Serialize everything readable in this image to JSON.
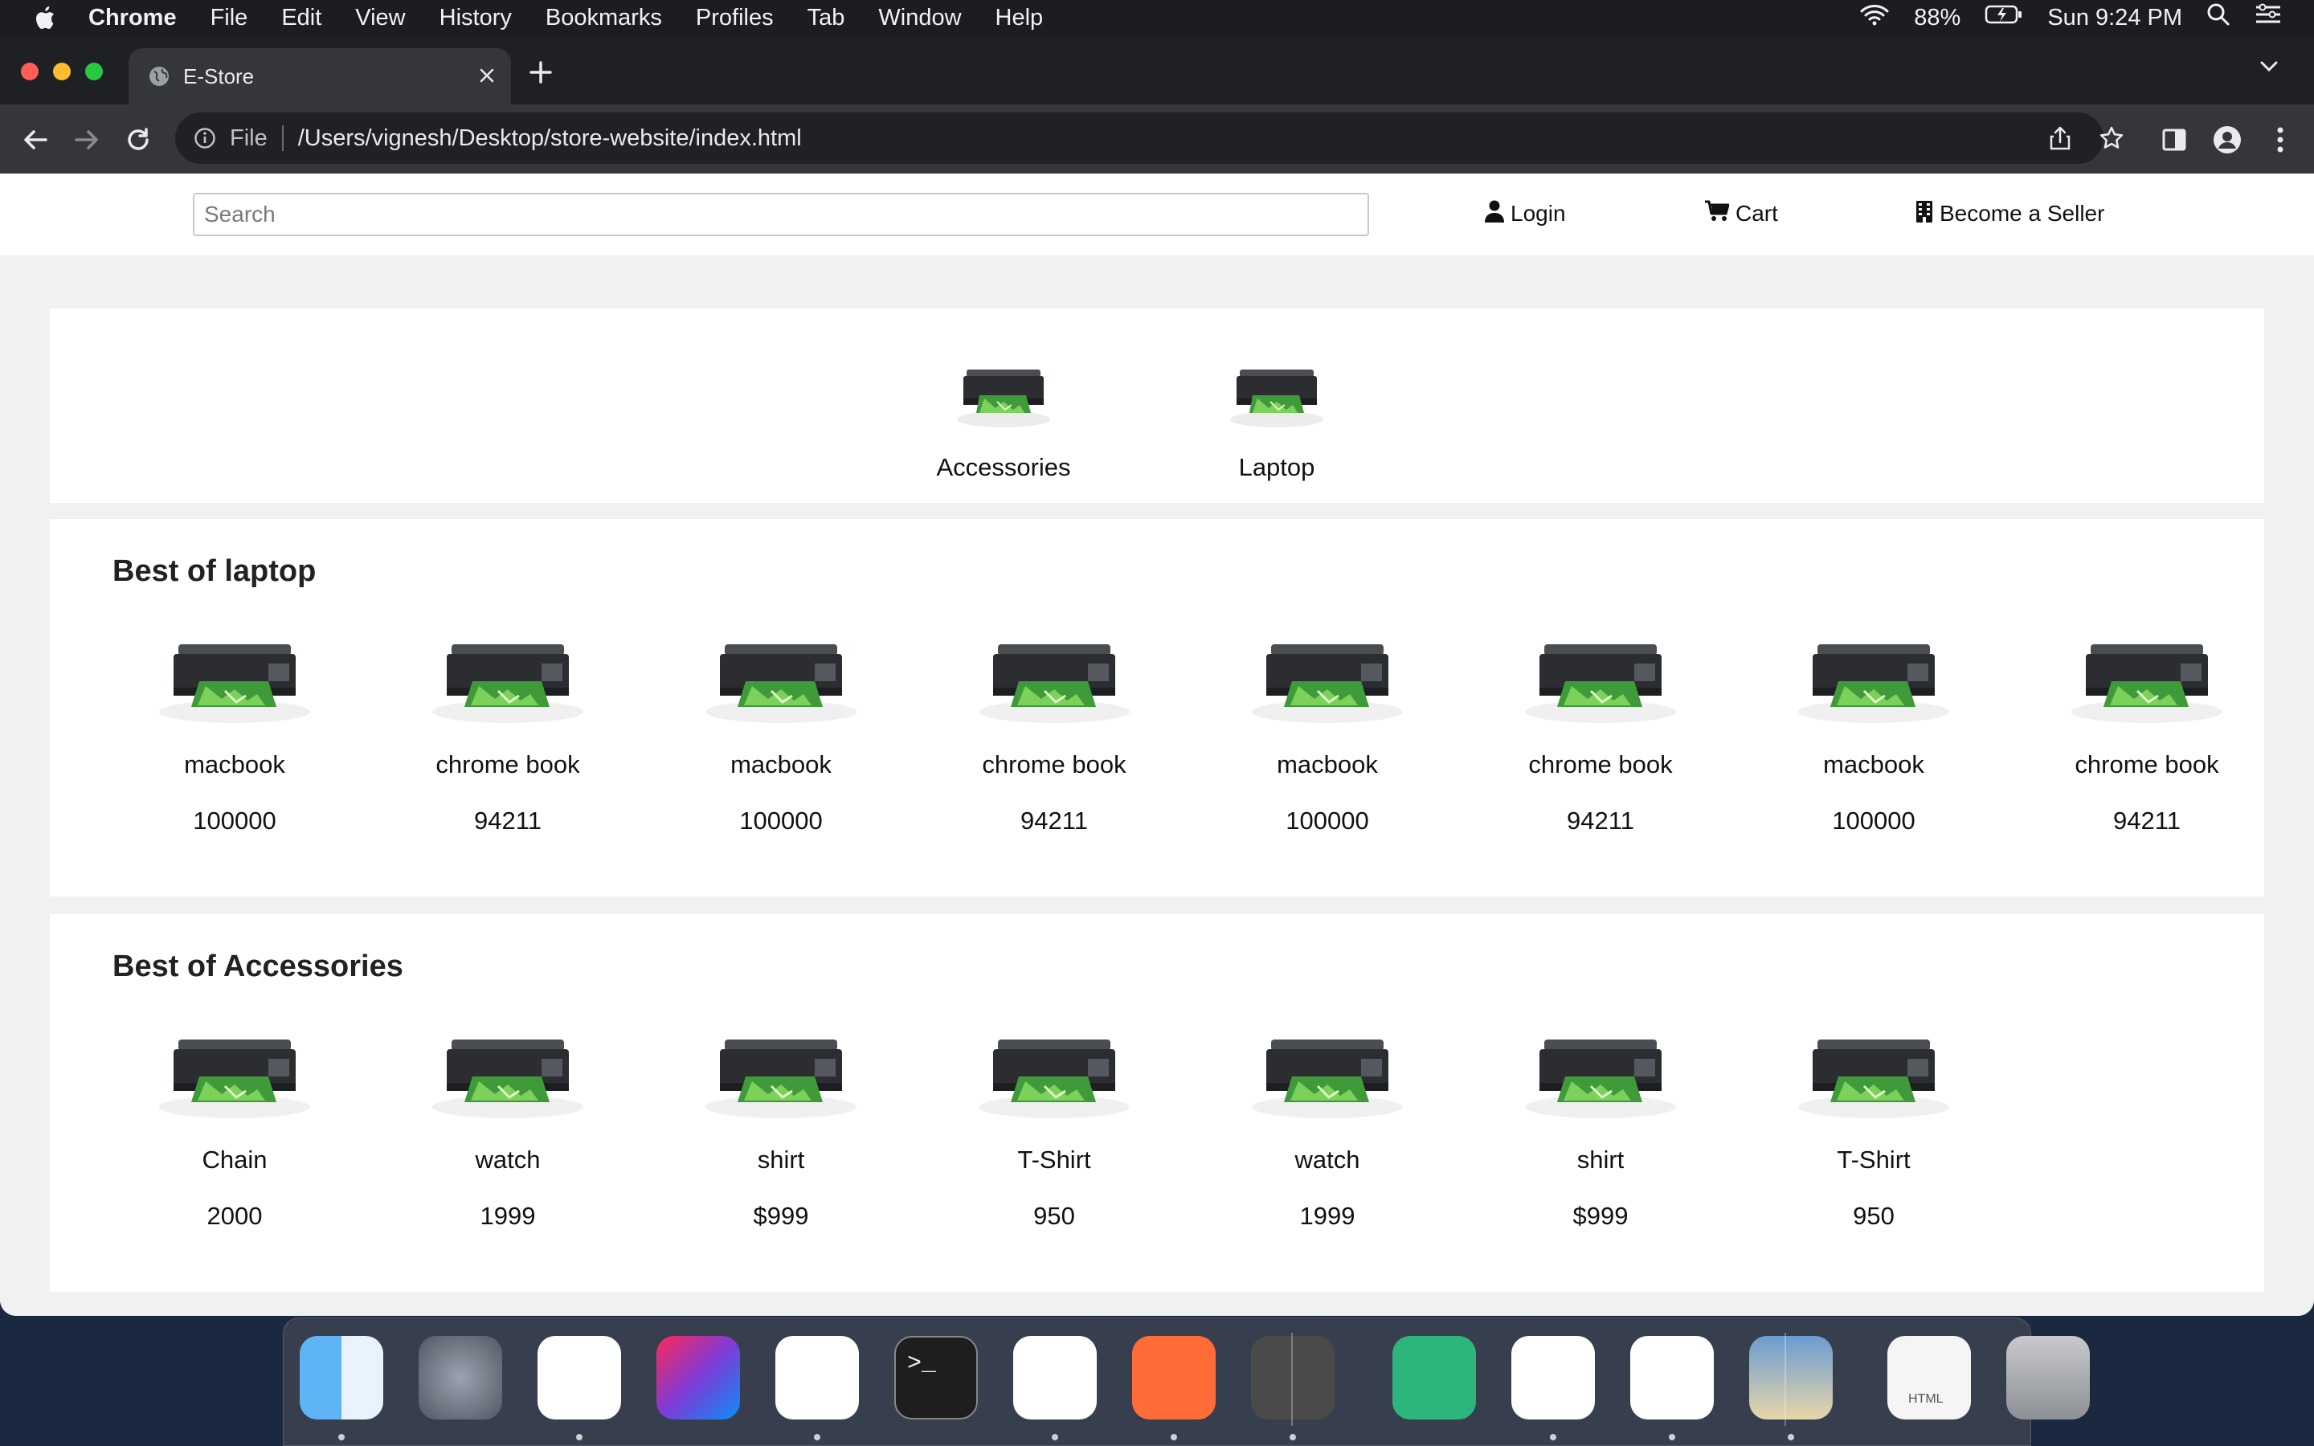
{
  "menubar": {
    "app_name": "Chrome",
    "items": [
      "File",
      "Edit",
      "View",
      "History",
      "Bookmarks",
      "Profiles",
      "Tab",
      "Window",
      "Help"
    ],
    "battery": "88%",
    "clock": "Sun 9:24 PM"
  },
  "browser": {
    "tab_title": "E-Store",
    "address_scheme": "File",
    "address_path": "/Users/vignesh/Desktop/store-website/index.html"
  },
  "site": {
    "search_placeholder": "Search",
    "login_label": "Login",
    "cart_label": "Cart",
    "seller_label": "Become a Seller"
  },
  "categories": [
    {
      "label": "Accessories"
    },
    {
      "label": "Laptop"
    }
  ],
  "sections": [
    {
      "title": "Best of laptop",
      "products": [
        {
          "name": "macbook",
          "price": "100000"
        },
        {
          "name": "chrome book",
          "price": "94211"
        },
        {
          "name": "macbook",
          "price": "100000"
        },
        {
          "name": "chrome book",
          "price": "94211"
        },
        {
          "name": "macbook",
          "price": "100000"
        },
        {
          "name": "chrome book",
          "price": "94211"
        },
        {
          "name": "macbook",
          "price": "100000"
        },
        {
          "name": "chrome book",
          "price": "94211"
        }
      ]
    },
    {
      "title": "Best of Accessories",
      "products": [
        {
          "name": "Chain",
          "price": "2000"
        },
        {
          "name": "watch",
          "price": "1999"
        },
        {
          "name": "shirt",
          "price": "$999"
        },
        {
          "name": "T-Shirt",
          "price": "950"
        },
        {
          "name": "watch",
          "price": "1999"
        },
        {
          "name": "shirt",
          "price": "$999"
        },
        {
          "name": "T-Shirt",
          "price": "950"
        }
      ]
    }
  ],
  "dock": {
    "apps": [
      "finder-icon",
      "launchpad-icon",
      "teams-icon",
      "intellij-icon",
      "chrome-icon",
      "terminal-icon",
      "dbeaver-icon",
      "postman-icon",
      "sublime-text-icon",
      "tableplus-icon",
      "mongodb-compass-icon",
      "vscode-icon",
      "preview-icon",
      "html-document-icon",
      "trash-icon"
    ],
    "trash_label": "HTML"
  },
  "colors": {
    "menubar": "#1c1d22",
    "tabstrip": "#1f2023",
    "toolbar": "#35363a",
    "page_bg": "#f1f1f1",
    "panel_bg": "#ffffff"
  }
}
